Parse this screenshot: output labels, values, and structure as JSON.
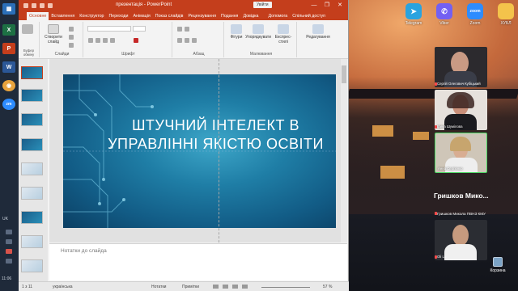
{
  "window": {
    "title": "презентація  -  PowerPoint",
    "signin_label": "Увійти",
    "controls": [
      "—",
      "❐",
      "✕"
    ]
  },
  "ribbon_tabs": [
    "Основне",
    "Вставлення",
    "Конструктор",
    "Переходи",
    "Анімація",
    "Показ слайдів",
    "Рецензування",
    "Подання",
    "Довідка",
    "Допомога",
    "Спільний доступ"
  ],
  "ribbon": {
    "groups": [
      "Буфер обміну",
      "Слайди",
      "Шрифт",
      "Абзац",
      "Малювання",
      "Редагування"
    ],
    "paste_label": "Вставити",
    "new_slide_label": "Створити слайд",
    "shapes_label": "Фігури",
    "arrange_label": "Упорядкувати",
    "quick_styles_label": "Експрес-стилі",
    "editing_label": "Редагування"
  },
  "slide": {
    "title": "ШТУЧНИЙ ІНТЕЛЕКТ В УПРАВЛІННІ ЯКІСТЮ ОСВІТИ",
    "accent": "#1f7ea6"
  },
  "notes": {
    "placeholder": "Нотатки до слайда"
  },
  "status": {
    "slide_counter": "1 з 11",
    "language": "українська",
    "notes_label": "Нотатки",
    "comments_label": "Примітки",
    "zoom": "57 %"
  },
  "desktop_icons": [
    {
      "label": "Telegram",
      "icon": "telegram-icon",
      "color": "#2aa3df",
      "glyph": "➤"
    },
    {
      "label": "Viber",
      "icon": "viber-icon",
      "color": "#7360f2",
      "glyph": "✆"
    },
    {
      "label": "Zoom",
      "icon": "zoom-icon",
      "color": "#2d8cff",
      "glyph": "zoom"
    },
    {
      "label": "ХУБЛ",
      "icon": "folder-icon",
      "color": "#f4c34b",
      "glyph": "▬"
    }
  ],
  "taskbar": {
    "language": "UK",
    "clock": "11:06",
    "apps": [
      {
        "icon": "excel-icon",
        "color": "#1d7044",
        "glyph": "X"
      },
      {
        "icon": "powerpoint-icon",
        "color": "#c43e1c",
        "glyph": "P"
      },
      {
        "icon": "word-icon",
        "color": "#2b5797",
        "glyph": "W"
      },
      {
        "icon": "chrome-icon",
        "color": "#e8a33d",
        "glyph": "◉"
      },
      {
        "icon": "zoom-taskbar-icon",
        "color": "#2d8cff",
        "glyph": "zm"
      }
    ]
  },
  "participants": [
    {
      "name": "Сергій Олегович Кубіцький"
    },
    {
      "name": "Ірина Шумілова"
    },
    {
      "name": "Анна Сергієнко"
    },
    {
      "name": "Гришков Мико..."
    },
    {
      "name": "Гришков Микола ПВНЗ КМУ"
    },
    {
      "name": "Oli Lo"
    }
  ],
  "recycle_bin_label": "Корзина"
}
